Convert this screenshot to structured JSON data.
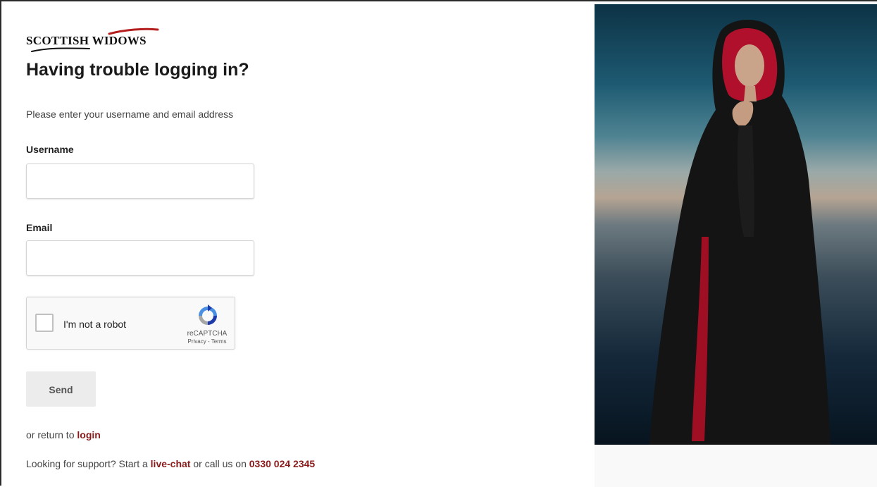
{
  "brand": {
    "name": "SCOTTISH WIDOWS",
    "accent": "#b51e1e",
    "link_color": "#8b1a1a"
  },
  "heading": "Having trouble logging in?",
  "intro": "Please enter your username and email address",
  "form": {
    "username": {
      "label": "Username",
      "value": "",
      "placeholder": ""
    },
    "email": {
      "label": "Email",
      "value": "",
      "placeholder": ""
    },
    "captcha": {
      "label": "I'm not a robot",
      "brand": "reCAPTCHA",
      "privacy": "Privacy",
      "separator": " - ",
      "terms": "Terms",
      "checked": false
    },
    "send_label": "Send"
  },
  "return": {
    "prefix": "or return to ",
    "link": "login"
  },
  "support": {
    "prefix": "Looking for support? Start a ",
    "chat_link": "live-chat",
    "middle": " or call us on ",
    "phone": "0330 024 2345"
  },
  "hero": {
    "image": "woman-in-hooded-cloak-photo"
  }
}
